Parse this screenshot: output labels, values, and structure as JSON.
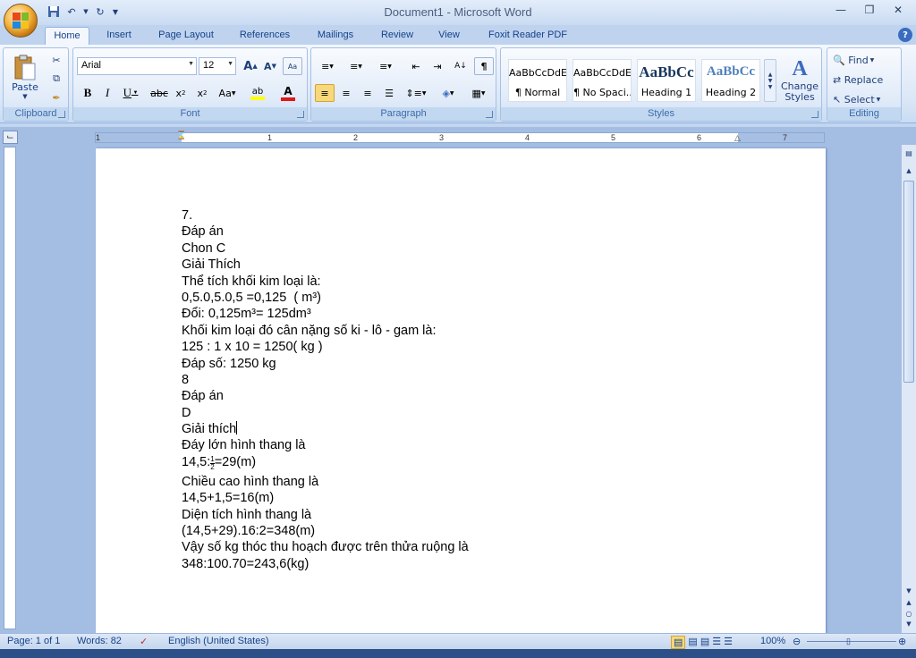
{
  "app": {
    "title": "Document1 - Microsoft Word"
  },
  "qat": {
    "save_icon": "save-icon",
    "undo_icon": "undo-icon",
    "redo_icon": "redo-icon"
  },
  "tabs": [
    {
      "label": "Home"
    },
    {
      "label": "Insert"
    },
    {
      "label": "Page Layout"
    },
    {
      "label": "References"
    },
    {
      "label": "Mailings"
    },
    {
      "label": "Review"
    },
    {
      "label": "View"
    },
    {
      "label": "Foxit Reader PDF"
    }
  ],
  "ribbon": {
    "clipboard": {
      "label": "Clipboard",
      "paste": "Paste"
    },
    "font": {
      "label": "Font",
      "family": "Arial",
      "size": "12"
    },
    "paragraph": {
      "label": "Paragraph"
    },
    "styles": {
      "label": "Styles",
      "items": [
        {
          "preview": "AaBbCcDdE",
          "name": "¶ Normal"
        },
        {
          "preview": "AaBbCcDdE",
          "name": "¶ No Spaci..."
        },
        {
          "preview": "AaBbCc",
          "name": "Heading 1"
        },
        {
          "preview": "AaBbCc",
          "name": "Heading 2"
        }
      ],
      "change_styles": "Change Styles"
    },
    "editing": {
      "label": "Editing",
      "find": "Find",
      "replace": "Replace",
      "select": "Select"
    }
  },
  "ruler": {
    "numbers": [
      "1",
      "1",
      "2",
      "3",
      "4",
      "5",
      "6",
      "7"
    ]
  },
  "document": {
    "lines": [
      "7.",
      "Đáp án",
      "Chon C",
      "Giải Thích",
      "Thể tích khối kim loại là:",
      "0,5.0,5.0,5 =0,125  ( m³)",
      "Đổi: 0,125m³= 125dm³",
      "Khối kim loại đó cân nặng số ki - lô - gam là:",
      "125 : 1 x 10 = 1250( kg )",
      "Đáp số: 1250 kg",
      "8",
      "Đáp án",
      "D",
      "Giải thích",
      "Đáy lớn hình thang là",
      "14,5:",
      "Chiều cao hình thang là",
      "14,5+1,5=16(m)",
      "Diện tích hình thang là",
      "(14,5+29).16:2=348(m)",
      "Vậy số kg thóc thu hoạch được trên thửa ruộng là",
      "348:100.70=243,6(kg)"
    ],
    "frac_num": "1",
    "frac_den": "2",
    "frac_tail": "=29(m)"
  },
  "status": {
    "page": "Page: 1 of 1",
    "words": "Words: 82",
    "language": "English (United States)",
    "zoom": "100%"
  }
}
